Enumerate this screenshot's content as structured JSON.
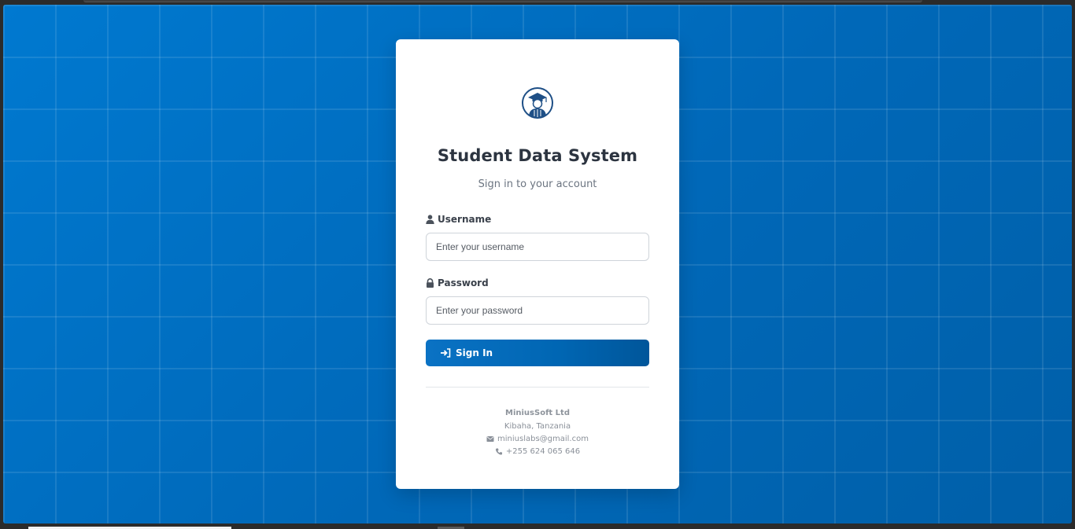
{
  "app": {
    "title": "Student Data System",
    "subtitle": "Sign in to your account"
  },
  "form": {
    "username": {
      "label": "Username",
      "placeholder": "Enter your username",
      "value": ""
    },
    "password": {
      "label": "Password",
      "placeholder": "Enter your password",
      "value": ""
    },
    "submit_label": "Sign In"
  },
  "footer": {
    "company": "MiniusSoft Ltd",
    "location": "Kibaha, Tanzania",
    "email": "miniuslabs@gmail.com",
    "phone": "+255 624 065 646"
  },
  "icons": {
    "logo": "graduate-student-icon",
    "username": "user-icon",
    "password": "lock-icon",
    "submit": "sign-in-icon",
    "email": "envelope-icon",
    "phone": "phone-icon"
  },
  "colors": {
    "background": "#0070c4",
    "accent": "#0066b3",
    "card": "#ffffff",
    "title_text": "#2c3440",
    "logo": "#1e4f86"
  }
}
